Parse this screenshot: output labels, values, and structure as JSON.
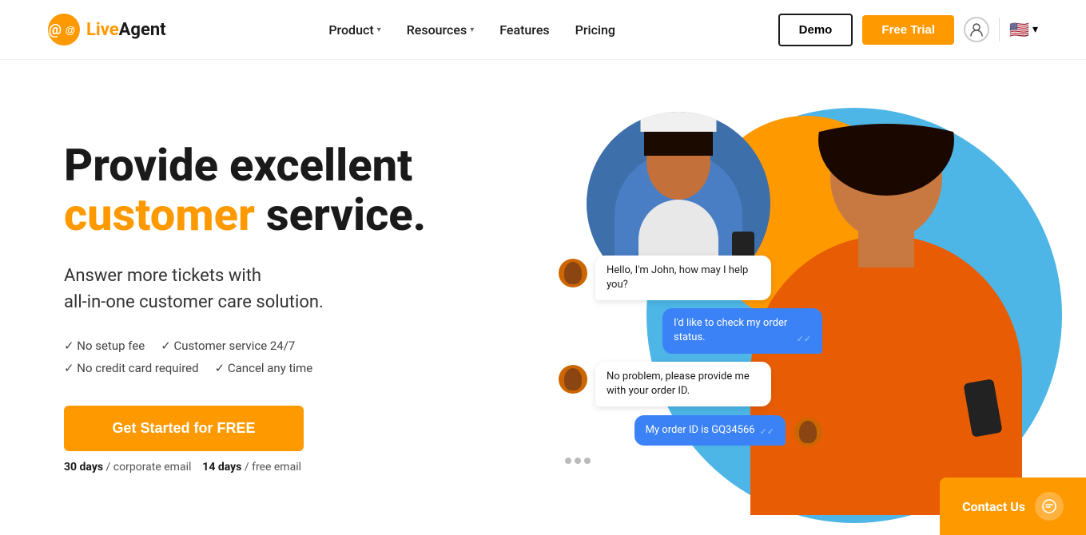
{
  "logo": {
    "icon": "@",
    "brand_live": "Live",
    "brand_agent": "Agent"
  },
  "nav": {
    "links": [
      {
        "label": "Product",
        "has_dropdown": true
      },
      {
        "label": "Resources",
        "has_dropdown": true
      },
      {
        "label": "Features",
        "has_dropdown": false
      },
      {
        "label": "Pricing",
        "has_dropdown": false
      }
    ],
    "btn_demo": "Demo",
    "btn_free_trial": "Free Trial",
    "lang": "EN"
  },
  "hero": {
    "title_line1": "Provide excellent",
    "title_highlight": "customer",
    "title_line2": " service.",
    "subtitle_line1": "Answer more tickets with",
    "subtitle_line2": "all-in-one customer care solution.",
    "check1": "✓ No setup fee",
    "check2": "✓ Customer service 24/7",
    "check3": "✓ No credit card required",
    "check4": "✓ Cancel any time",
    "cta_button": "Get Started for FREE",
    "trial_days_corporate": "30 days",
    "trial_label_corporate": "/ corporate email",
    "trial_days_free": "14 days",
    "trial_label_free": "/ free email"
  },
  "chat": {
    "bubble1": "Hello, I'm John, how may I help you?",
    "bubble2": "I'd like to check my order status.",
    "bubble3": "No problem, please provide me with your order ID.",
    "bubble4": "My order ID is GQ34566",
    "check_marks": "✓✓"
  },
  "contact_us": {
    "label": "Contact Us"
  },
  "colors": {
    "orange": "#FF9900",
    "blue": "#3B82F6",
    "dark": "#1a1a1a"
  }
}
